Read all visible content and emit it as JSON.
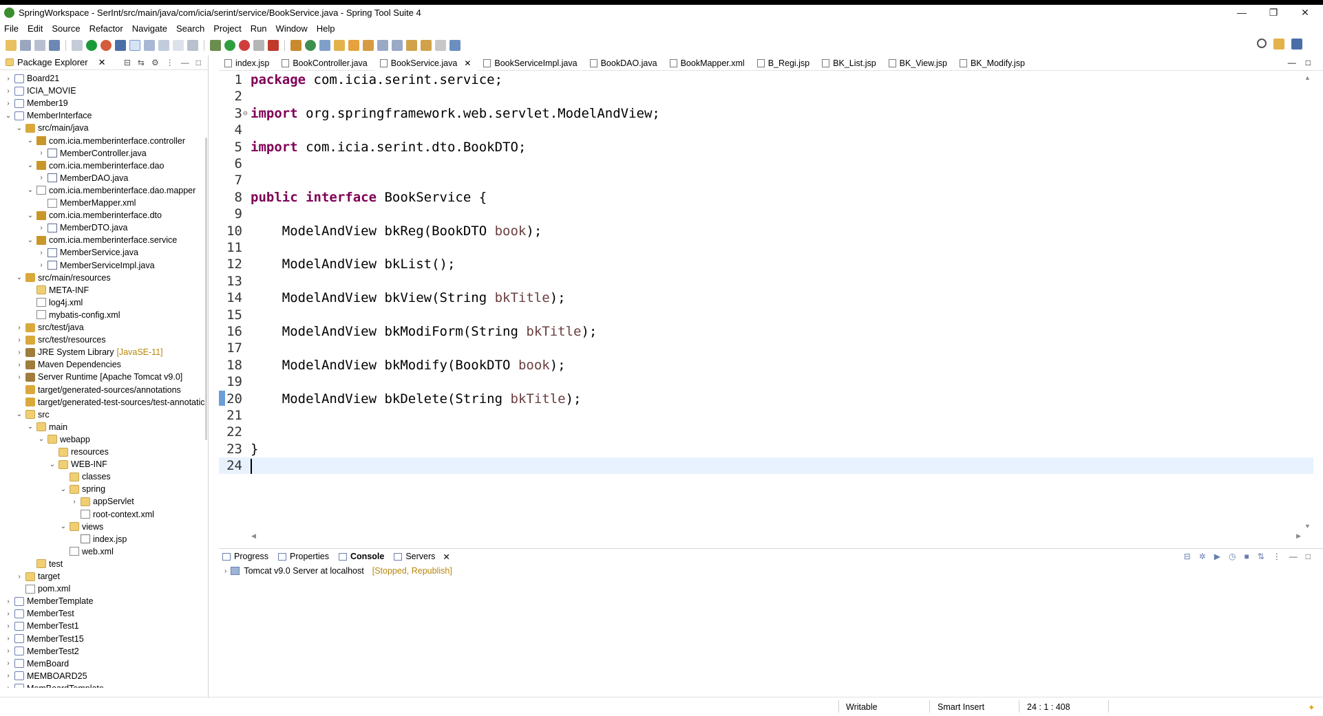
{
  "window": {
    "title": "SpringWorkspace - SerInt/src/main/java/com/icia/serint/service/BookService.java - Spring Tool Suite 4",
    "minimize": "—",
    "restore": "❐",
    "close": "✕"
  },
  "menu": [
    "File",
    "Edit",
    "Source",
    "Refactor",
    "Navigate",
    "Search",
    "Project",
    "Run",
    "Window",
    "Help"
  ],
  "package_explorer": {
    "title": "Package Explorer",
    "tree": [
      {
        "label": "Board21",
        "depth": 0,
        "twisty": "›",
        "icon": "project"
      },
      {
        "label": "ICIA_MOVIE",
        "depth": 0,
        "twisty": "›",
        "icon": "project"
      },
      {
        "label": "Member19",
        "depth": 0,
        "twisty": "›",
        "icon": "project"
      },
      {
        "label": "MemberInterface",
        "depth": 0,
        "twisty": "⌄",
        "icon": "project"
      },
      {
        "label": "src/main/java",
        "depth": 1,
        "twisty": "⌄",
        "icon": "srcfolder"
      },
      {
        "label": "com.icia.memberinterface.controller",
        "depth": 2,
        "twisty": "⌄",
        "icon": "package"
      },
      {
        "label": "MemberController.java",
        "depth": 3,
        "twisty": "›",
        "icon": "java"
      },
      {
        "label": "com.icia.memberinterface.dao",
        "depth": 2,
        "twisty": "⌄",
        "icon": "package"
      },
      {
        "label": "MemberDAO.java",
        "depth": 3,
        "twisty": "›",
        "icon": "java"
      },
      {
        "label": "com.icia.memberinterface.dao.mapper",
        "depth": 2,
        "twisty": "⌄",
        "icon": "package-empty"
      },
      {
        "label": "MemberMapper.xml",
        "depth": 3,
        "twisty": "",
        "icon": "xml"
      },
      {
        "label": "com.icia.memberinterface.dto",
        "depth": 2,
        "twisty": "⌄",
        "icon": "package"
      },
      {
        "label": "MemberDTO.java",
        "depth": 3,
        "twisty": "›",
        "icon": "java"
      },
      {
        "label": "com.icia.memberinterface.service",
        "depth": 2,
        "twisty": "⌄",
        "icon": "package"
      },
      {
        "label": "MemberService.java",
        "depth": 3,
        "twisty": "›",
        "icon": "java"
      },
      {
        "label": "MemberServiceImpl.java",
        "depth": 3,
        "twisty": "›",
        "icon": "java"
      },
      {
        "label": "src/main/resources",
        "depth": 1,
        "twisty": "⌄",
        "icon": "srcfolder"
      },
      {
        "label": "META-INF",
        "depth": 2,
        "twisty": "",
        "icon": "folder"
      },
      {
        "label": "log4j.xml",
        "depth": 2,
        "twisty": "",
        "icon": "xml"
      },
      {
        "label": "mybatis-config.xml",
        "depth": 2,
        "twisty": "",
        "icon": "xml"
      },
      {
        "label": "src/test/java",
        "depth": 1,
        "twisty": "›",
        "icon": "srcfolder"
      },
      {
        "label": "src/test/resources",
        "depth": 1,
        "twisty": "›",
        "icon": "srcfolder"
      },
      {
        "label": "JRE System Library",
        "depth": 1,
        "twisty": "›",
        "icon": "library",
        "decor": "[JavaSE-11]"
      },
      {
        "label": "Maven Dependencies",
        "depth": 1,
        "twisty": "›",
        "icon": "library"
      },
      {
        "label": "Server Runtime [Apache Tomcat v9.0]",
        "depth": 1,
        "twisty": "›",
        "icon": "library"
      },
      {
        "label": "target/generated-sources/annotations",
        "depth": 1,
        "twisty": "",
        "icon": "srcfolder"
      },
      {
        "label": "target/generated-test-sources/test-annotatic",
        "depth": 1,
        "twisty": "",
        "icon": "srcfolder"
      },
      {
        "label": "src",
        "depth": 1,
        "twisty": "⌄",
        "icon": "folder"
      },
      {
        "label": "main",
        "depth": 2,
        "twisty": "⌄",
        "icon": "folder"
      },
      {
        "label": "webapp",
        "depth": 3,
        "twisty": "⌄",
        "icon": "folder"
      },
      {
        "label": "resources",
        "depth": 4,
        "twisty": "",
        "icon": "folder"
      },
      {
        "label": "WEB-INF",
        "depth": 4,
        "twisty": "⌄",
        "icon": "folder"
      },
      {
        "label": "classes",
        "depth": 5,
        "twisty": "",
        "icon": "folder"
      },
      {
        "label": "spring",
        "depth": 5,
        "twisty": "⌄",
        "icon": "folder"
      },
      {
        "label": "appServlet",
        "depth": 6,
        "twisty": "›",
        "icon": "folder"
      },
      {
        "label": "root-context.xml",
        "depth": 6,
        "twisty": "",
        "icon": "xml"
      },
      {
        "label": "views",
        "depth": 5,
        "twisty": "⌄",
        "icon": "folder"
      },
      {
        "label": "index.jsp",
        "depth": 6,
        "twisty": "",
        "icon": "jsp"
      },
      {
        "label": "web.xml",
        "depth": 5,
        "twisty": "",
        "icon": "xml"
      },
      {
        "label": "test",
        "depth": 2,
        "twisty": "",
        "icon": "folder"
      },
      {
        "label": "target",
        "depth": 1,
        "twisty": "›",
        "icon": "folder"
      },
      {
        "label": "pom.xml",
        "depth": 1,
        "twisty": "",
        "icon": "xml"
      },
      {
        "label": "MemberTemplate",
        "depth": 0,
        "twisty": "›",
        "icon": "project"
      },
      {
        "label": "MemberTest",
        "depth": 0,
        "twisty": "›",
        "icon": "project"
      },
      {
        "label": "MemberTest1",
        "depth": 0,
        "twisty": "›",
        "icon": "project"
      },
      {
        "label": "MemberTest15",
        "depth": 0,
        "twisty": "›",
        "icon": "project"
      },
      {
        "label": "MemberTest2",
        "depth": 0,
        "twisty": "›",
        "icon": "project"
      },
      {
        "label": "MemBoard",
        "depth": 0,
        "twisty": "›",
        "icon": "project"
      },
      {
        "label": "MEMBOARD25",
        "depth": 0,
        "twisty": "›",
        "icon": "project"
      },
      {
        "label": "MemBoardTemplate",
        "depth": 0,
        "twisty": "›",
        "icon": "project"
      }
    ]
  },
  "editor": {
    "tabs": [
      {
        "label": "index.jsp",
        "active": false
      },
      {
        "label": "BookController.java",
        "active": false
      },
      {
        "label": "BookService.java",
        "active": true
      },
      {
        "label": "BookServiceImpl.java",
        "active": false
      },
      {
        "label": "BookDAO.java",
        "active": false
      },
      {
        "label": "BookMapper.xml",
        "active": false
      },
      {
        "label": "B_Regi.jsp",
        "active": false
      },
      {
        "label": "BK_List.jsp",
        "active": false
      },
      {
        "label": "BK_View.jsp",
        "active": false
      },
      {
        "label": "BK_Modify.jsp",
        "active": false
      }
    ],
    "lines": [
      {
        "n": "1",
        "code": "package com.icia.serint.service;"
      },
      {
        "n": "2",
        "code": ""
      },
      {
        "n": "3",
        "code": "import org.springframework.web.servlet.ModelAndView;"
      },
      {
        "n": "4",
        "code": ""
      },
      {
        "n": "5",
        "code": "import com.icia.serint.dto.BookDTO;"
      },
      {
        "n": "6",
        "code": ""
      },
      {
        "n": "7",
        "code": ""
      },
      {
        "n": "8",
        "code": "public interface BookService {"
      },
      {
        "n": "9",
        "code": ""
      },
      {
        "n": "10",
        "code": "    ModelAndView bkReg(BookDTO book);"
      },
      {
        "n": "11",
        "code": ""
      },
      {
        "n": "12",
        "code": "    ModelAndView bkList();"
      },
      {
        "n": "13",
        "code": ""
      },
      {
        "n": "14",
        "code": "    ModelAndView bkView(String bkTitle);"
      },
      {
        "n": "15",
        "code": ""
      },
      {
        "n": "16",
        "code": "    ModelAndView bkModiForm(String bkTitle);"
      },
      {
        "n": "17",
        "code": ""
      },
      {
        "n": "18",
        "code": "    ModelAndView bkModify(BookDTO book);"
      },
      {
        "n": "19",
        "code": ""
      },
      {
        "n": "20",
        "code": "    ModelAndView bkDelete(String bkTitle);"
      },
      {
        "n": "21",
        "code": ""
      },
      {
        "n": "22",
        "code": ""
      },
      {
        "n": "23",
        "code": "}"
      },
      {
        "n": "24",
        "code": ""
      }
    ],
    "current_line": "24"
  },
  "bottom_panel": {
    "tabs": [
      {
        "label": "Progress",
        "active": false
      },
      {
        "label": "Properties",
        "active": false
      },
      {
        "label": "Console",
        "active": true
      },
      {
        "label": "Servers",
        "active": false,
        "closable": true
      }
    ],
    "server": {
      "label": "Tomcat v9.0 Server at localhost",
      "state": "[Stopped, Republish]"
    }
  },
  "status": {
    "mode": "Writable",
    "insert": "Smart Insert",
    "position": "24 : 1 : 408"
  },
  "colors": {
    "keyword": "#7f0055",
    "parameter": "#6a3e3e",
    "current_line": "#e8f2fe",
    "decoration": "#b8860b"
  }
}
